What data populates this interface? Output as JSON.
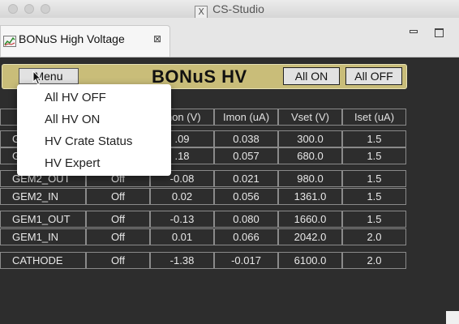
{
  "window": {
    "title": "CS-Studio",
    "x_icon": "X"
  },
  "tab": {
    "label": "BONuS High Voltage",
    "close": "⊠"
  },
  "header": {
    "menu_label": "Menu",
    "title": "BONuS HV",
    "all_on_label": "All ON",
    "all_off_label": "All OFF",
    "background_color": "#c9bd79"
  },
  "menu_items": [
    "All HV OFF",
    "All HV ON",
    "HV Crate Status",
    "HV Expert"
  ],
  "table": {
    "headers": {
      "imon": "Imon (uA)",
      "vset": "Vset (V)",
      "iset": "Iset (uA)",
      "vmon_partial": "mon (V)"
    },
    "rows": [
      {
        "name": "G",
        "status": "",
        "vmon": ".09",
        "imon": "0.038",
        "vset": "300.0",
        "iset": "1.5"
      },
      {
        "name": "G",
        "status": "",
        "vmon": ".18",
        "imon": "0.057",
        "vset": "680.0",
        "iset": "1.5"
      },
      {
        "name": "GEM2_OUT",
        "status": "Off",
        "vmon": "-0.08",
        "imon": "0.021",
        "vset": "980.0",
        "iset": "1.5"
      },
      {
        "name": "GEM2_IN",
        "status": "Off",
        "vmon": "0.02",
        "imon": "0.056",
        "vset": "1361.0",
        "iset": "1.5"
      },
      {
        "name": "GEM1_OUT",
        "status": "Off",
        "vmon": "-0.13",
        "imon": "0.080",
        "vset": "1660.0",
        "iset": "1.5"
      },
      {
        "name": "GEM1_IN",
        "status": "Off",
        "vmon": "0.01",
        "imon": "0.066",
        "vset": "2042.0",
        "iset": "2.0"
      },
      {
        "name": "CATHODE",
        "status": "Off",
        "vmon": "-1.38",
        "imon": "-0.017",
        "vset": "6100.0",
        "iset": "2.0"
      }
    ]
  },
  "icons": [
    "x-window-icon",
    "chart-tab-icon",
    "close-tab-icon",
    "minimize-icon",
    "maximize-icon",
    "mouse-pointer-icon"
  ]
}
